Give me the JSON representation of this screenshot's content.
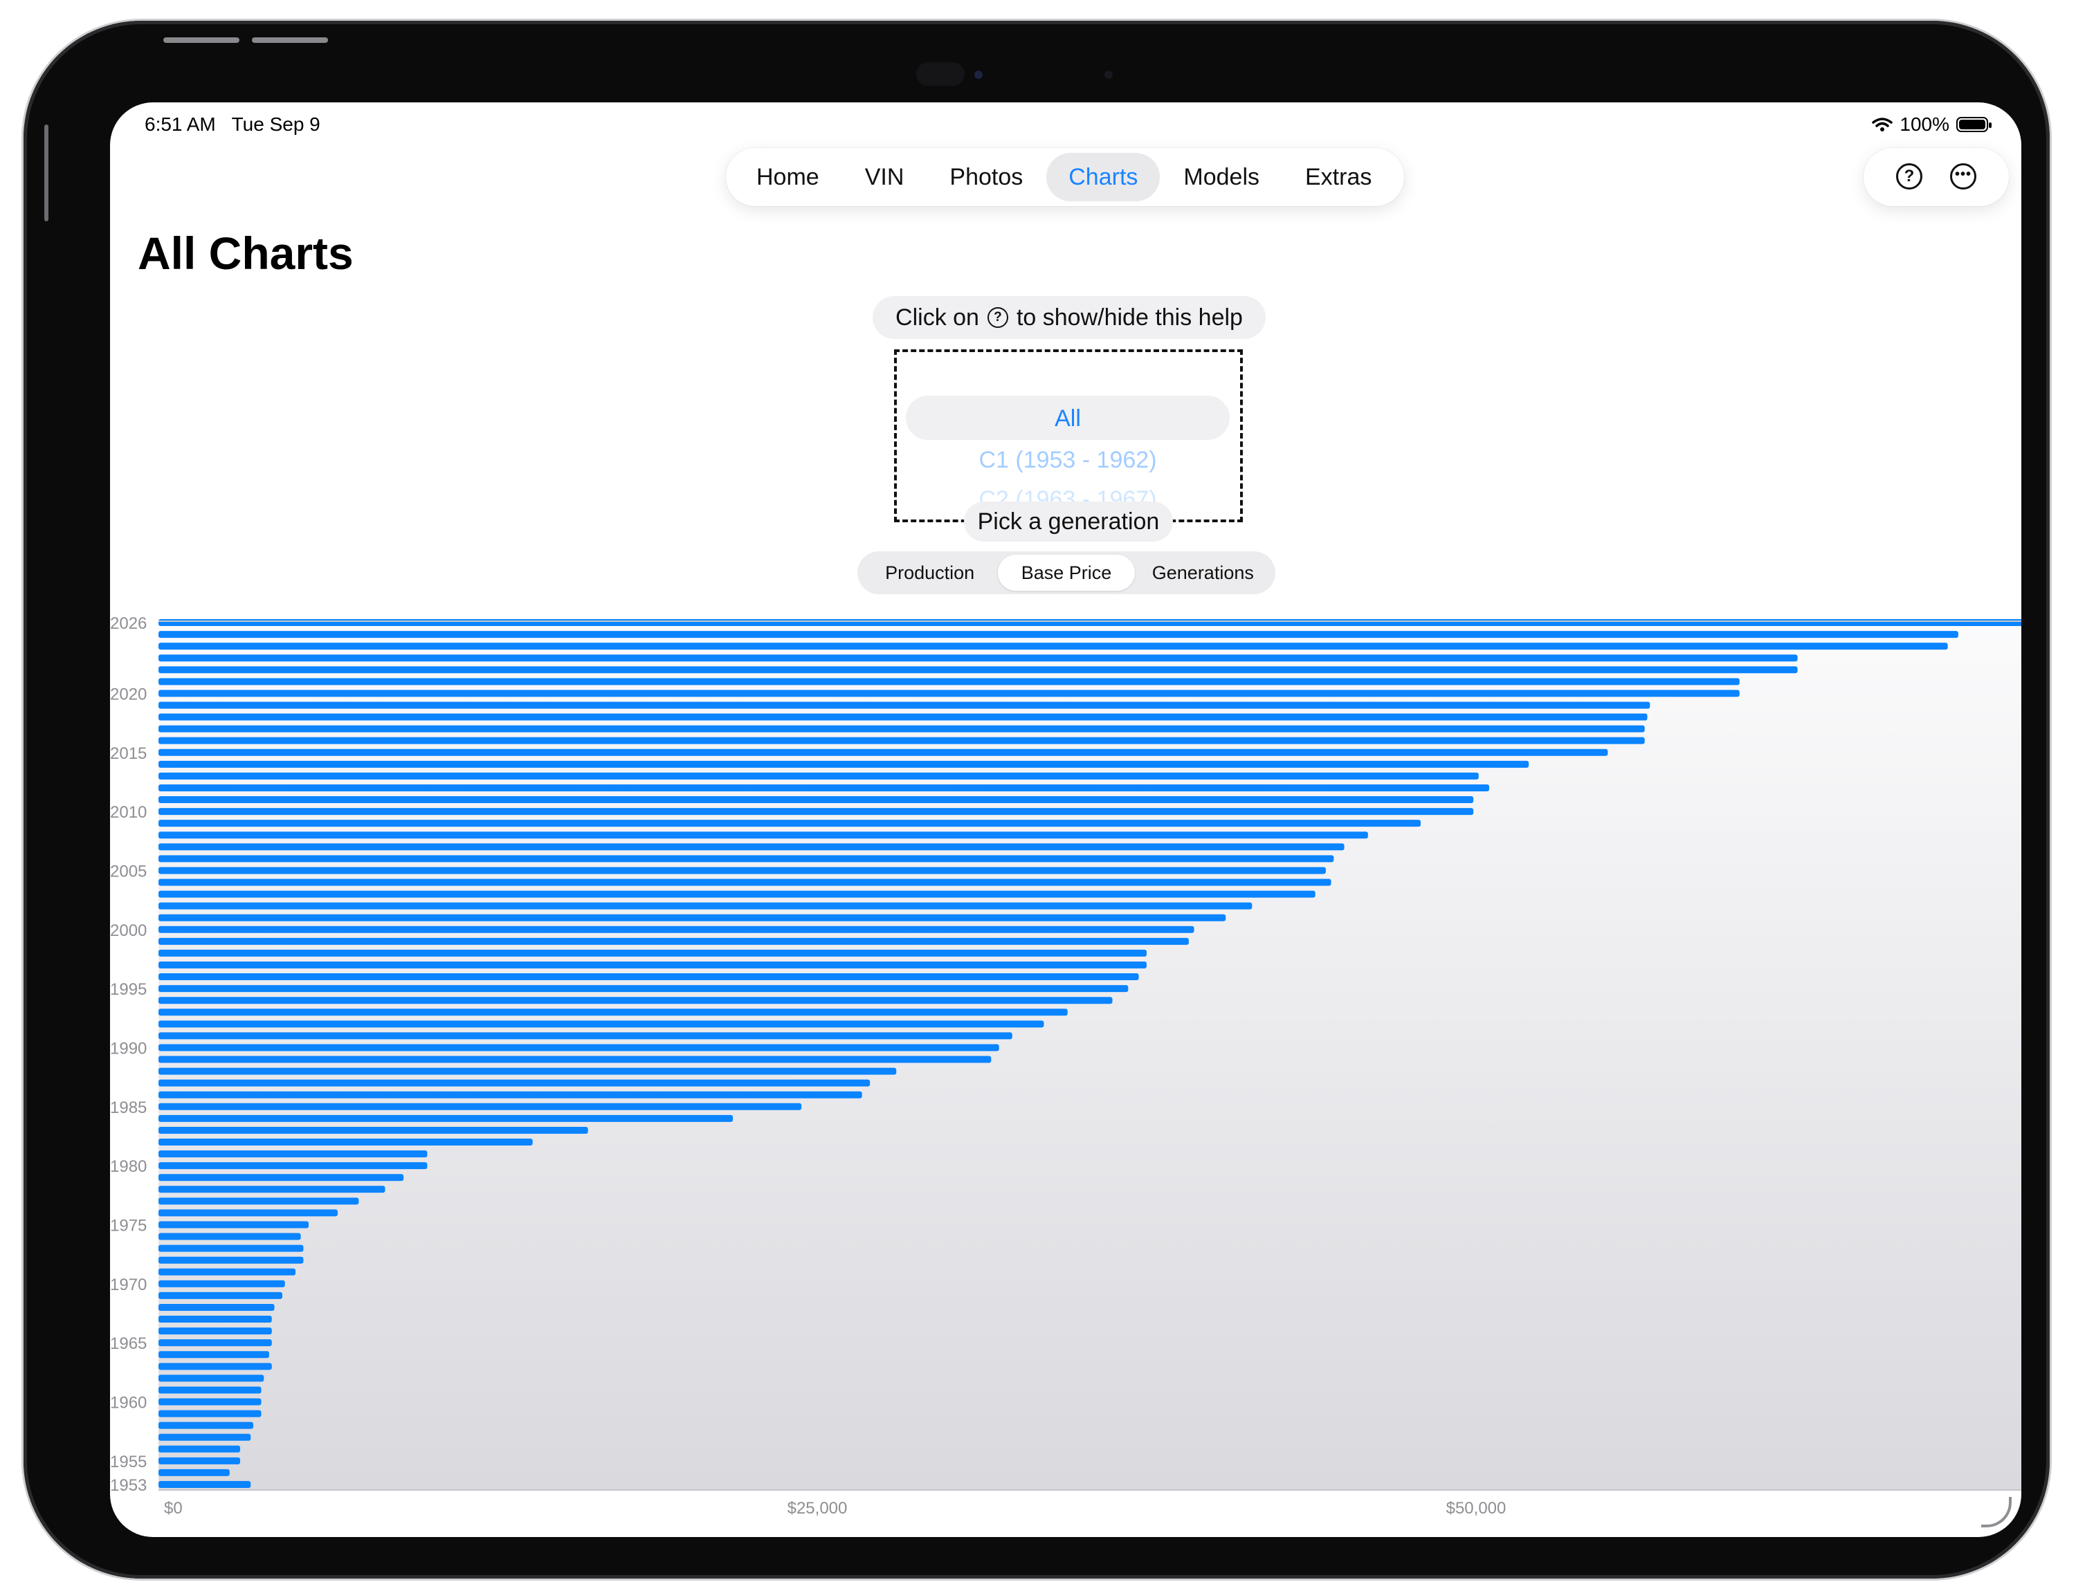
{
  "status_bar": {
    "time": "6:51 AM",
    "date": "Tue Sep 9",
    "battery": "100%"
  },
  "nav": {
    "tabs": [
      {
        "label": "Home",
        "active": false
      },
      {
        "label": "VIN",
        "active": false
      },
      {
        "label": "Photos",
        "active": false
      },
      {
        "label": "Charts",
        "active": true
      },
      {
        "label": "Models",
        "active": false
      },
      {
        "label": "Extras",
        "active": false
      }
    ],
    "help_icon": "question-circle-icon",
    "more_icon": "ellipsis-circle-icon"
  },
  "page": {
    "title": "All Charts",
    "help_before": "Click on",
    "help_after": "to show/hide this help",
    "picker_label": "Pick a generation",
    "generation_options": [
      "All",
      "C1 (1953 - 1962)",
      "C2 (1963 - 1967)"
    ],
    "selected_generation": "All",
    "segments": [
      {
        "label": "Production",
        "active": false
      },
      {
        "label": "Base Price",
        "active": true
      },
      {
        "label": "Generations",
        "active": false
      }
    ]
  },
  "colors": {
    "accent": "#1a84ff",
    "bar": "#0a84ff"
  },
  "chart_data": {
    "type": "bar",
    "orientation": "horizontal",
    "x_ticks": [
      "$0",
      "$25,000",
      "$50,000"
    ],
    "x_tick_values": [
      0,
      25000,
      50000
    ],
    "xlim": [
      0,
      75000
    ],
    "y_ticks": [
      "2026",
      "2020",
      "2015",
      "2010",
      "2005",
      "2000",
      "1995",
      "1990",
      "1985",
      "1980",
      "1975",
      "1970",
      "1965",
      "1960",
      "1955",
      "1953"
    ],
    "categories": [
      2026,
      2025,
      2024,
      2023,
      2022,
      2021,
      2020,
      2019,
      2018,
      2017,
      2016,
      2015,
      2014,
      2013,
      2012,
      2011,
      2010,
      2009,
      2008,
      2007,
      2006,
      2005,
      2004,
      2003,
      2002,
      2001,
      2000,
      1999,
      1998,
      1997,
      1996,
      1995,
      1994,
      1993,
      1992,
      1991,
      1990,
      1989,
      1988,
      1987,
      1986,
      1985,
      1984,
      1983,
      1982,
      1981,
      1980,
      1979,
      1978,
      1977,
      1976,
      1975,
      1974,
      1973,
      1972,
      1971,
      1970,
      1969,
      1968,
      1967,
      1966,
      1965,
      1964,
      1963,
      1962,
      1961,
      1960,
      1959,
      1958,
      1957,
      1956,
      1955,
      1954,
      1953
    ],
    "values": [
      72000,
      68300,
      67900,
      62200,
      62200,
      60000,
      60000,
      56600,
      56500,
      56400,
      56400,
      55000,
      52000,
      50100,
      50500,
      49900,
      49900,
      47900,
      45900,
      45000,
      44600,
      44300,
      44500,
      43900,
      41500,
      40500,
      39300,
      39100,
      37500,
      37500,
      37200,
      36800,
      36200,
      34500,
      33600,
      32400,
      31900,
      31600,
      28000,
      27000,
      26700,
      24400,
      21800,
      16300,
      14200,
      10200,
      10200,
      9300,
      8600,
      7600,
      6800,
      5700,
      5400,
      5500,
      5500,
      5200,
      4800,
      4700,
      4400,
      4300,
      4300,
      4300,
      4200,
      4300,
      4000,
      3900,
      3900,
      3900,
      3600,
      3500,
      3100,
      3100,
      2700,
      3500
    ],
    "grid": false,
    "legend": "none"
  }
}
